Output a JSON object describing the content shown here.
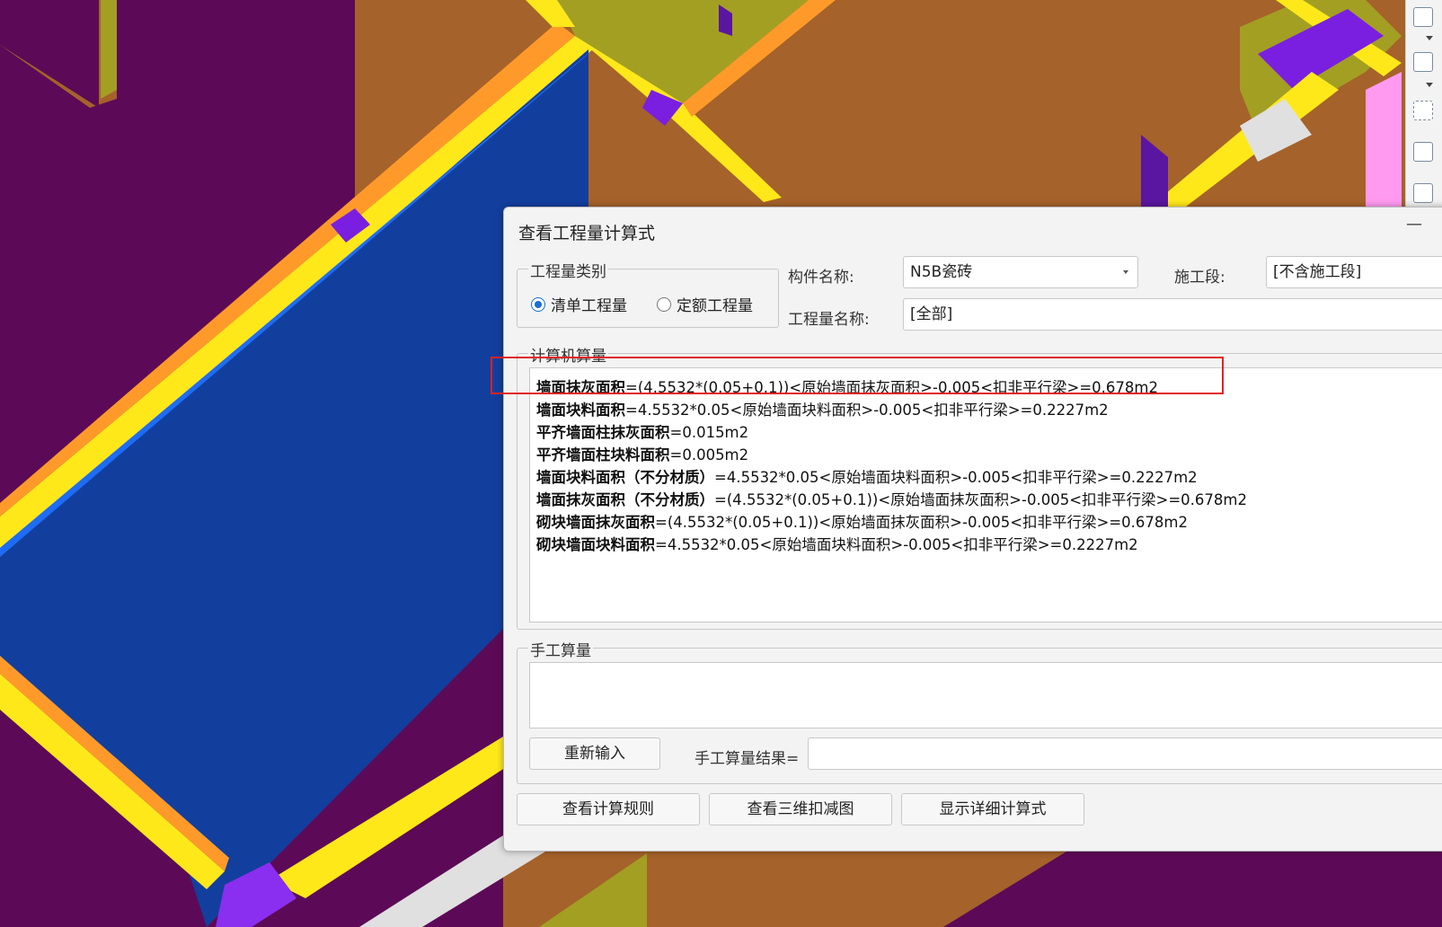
{
  "dialog": {
    "title": "查看工程量计算式",
    "minimize": "—",
    "category_group": {
      "legend": "工程量类别",
      "options": [
        {
          "label": "清单工程量",
          "checked": true
        },
        {
          "label": "定额工程量",
          "checked": false
        }
      ]
    },
    "component_label": "构件名称:",
    "component_value": "N5B瓷砖",
    "phase_label": "施工段:",
    "phase_value": "[不含施工段]",
    "quantity_name_label": "工程量名称:",
    "quantity_name_value": "[全部]",
    "computed_group": {
      "legend": "计算机算量",
      "lines": [
        {
          "name": "墙面抹灰面积",
          "formula": "=(4.5532*(0.05+0.1))<原始墙面抹灰面积>-0.005<扣非平行梁>=0.678m2"
        },
        {
          "name": "墙面块料面积",
          "formula": "=4.5532*0.05<原始墙面块料面积>-0.005<扣非平行梁>=0.2227m2"
        },
        {
          "name": "平齐墙面柱抹灰面积",
          "formula": "=0.015m2"
        },
        {
          "name": "平齐墙面柱块料面积",
          "formula": "=0.005m2"
        },
        {
          "name": "墙面块料面积（不分材质）",
          "formula": "=4.5532*0.05<原始墙面块料面积>-0.005<扣非平行梁>=0.2227m2"
        },
        {
          "name": "墙面抹灰面积（不分材质）",
          "formula": "=(4.5532*(0.05+0.1))<原始墙面抹灰面积>-0.005<扣非平行梁>=0.678m2"
        },
        {
          "name": "砌块墙面抹灰面积",
          "formula": "=(4.5532*(0.05+0.1))<原始墙面抹灰面积>-0.005<扣非平行梁>=0.678m2"
        },
        {
          "name": "砌块墙面块料面积",
          "formula": "=4.5532*0.05<原始墙面块料面积>-0.005<扣非平行梁>=0.2227m2"
        }
      ]
    },
    "manual_group": {
      "legend": "手工算量",
      "reenter_button": "重新输入",
      "result_label": "手工算量结果=",
      "result_value": ""
    },
    "buttons": {
      "view_rules": "查看计算规则",
      "view_3d": "查看三维扣减图",
      "show_detail": "显示详细计算式"
    }
  }
}
